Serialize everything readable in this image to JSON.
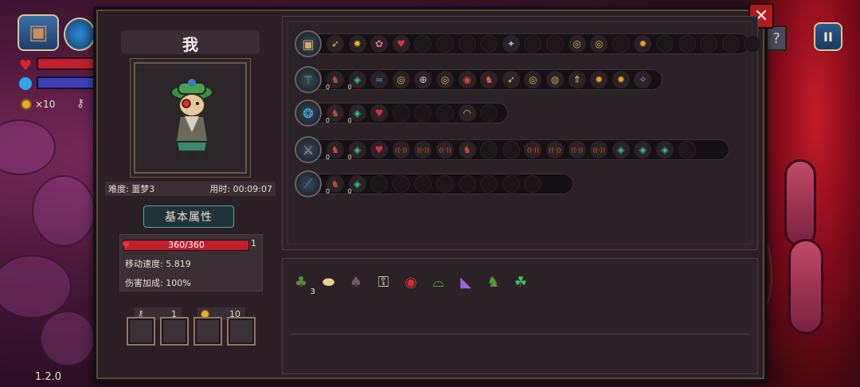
{
  "hud": {
    "coins": "×10",
    "version": "1.2.0",
    "pause_label": "II",
    "help_label": "?"
  },
  "panel": {
    "close_label": "✕"
  },
  "character": {
    "name": "我",
    "difficulty": "难度: 噩梦3",
    "time_used": "用时: 00:09:07",
    "attributes_button": "基本属性",
    "hp": "360/360",
    "armor": "1",
    "move_speed": "移动速度: 5.819",
    "damage_bonus": "伤害加成: 100%",
    "keys": "1",
    "gold": "10"
  },
  "weapon_rows": [
    {
      "main_icon": "chest-icon",
      "icons": [
        "feather-bolt-icon",
        "gold-orb-icon",
        "pink-gem-icon",
        "red-heart-icon",
        "empty",
        "empty",
        "empty",
        "empty",
        "blue-butterfly-icon",
        "empty",
        "empty",
        "golden-swirl-icon",
        "golden-swirl-icon",
        "empty",
        "sun-icon",
        "empty",
        "empty",
        "empty",
        "empty",
        "empty"
      ]
    },
    {
      "main_icon": "green-staff-icon",
      "icons": [
        "red-boot-icon",
        "teal-gem-icon",
        "blue-wave-icon",
        "golden-swirl-icon",
        "target-swirl-icon",
        "golden-swirl-icon",
        "red-swirl-icon",
        "fire-boot-icon",
        "feather-bolt-icon",
        "golden-swirl-icon",
        "dark-swirl-icon",
        "arrow-up-icon",
        "sun-icon",
        "sun-icon",
        "sparkle-icon"
      ],
      "counts": [
        "0",
        "0",
        "",
        "",
        "",
        "",
        "",
        "",
        "",
        "",
        "",
        "",
        "",
        "",
        ""
      ]
    },
    {
      "main_icon": "blue-orb-icon",
      "icons": [
        "red-boot-icon",
        "teal-gem-icon",
        "red-heart-icon",
        "empty",
        "empty",
        "empty",
        "rainbow-arc-icon",
        "empty"
      ],
      "counts": [
        "0",
        "0",
        "",
        "",
        "",
        "",
        "",
        ""
      ]
    },
    {
      "main_icon": "dark-staff-icon",
      "icons": [
        "red-boot-icon",
        "teal-gem-icon",
        "red-heart-icon",
        "radio-wave-icon",
        "radio-wave-icon",
        "radio-wave-icon",
        "red-boot-icon",
        "empty",
        "empty",
        "radio-wave-icon",
        "radio-wave-icon",
        "radio-wave-icon",
        "radio-wave-icon",
        "teal-gem-icon",
        "teal-gem-icon",
        "teal-gem-icon",
        "empty"
      ],
      "counts": [
        "0",
        "0",
        "",
        "",
        "",
        "",
        "",
        "",
        "",
        "",
        "",
        "",
        "",
        "",
        "",
        "",
        ""
      ]
    },
    {
      "main_icon": "blue-wand-icon",
      "icons": [
        "red-boot-icon",
        "teal-gem-icon",
        "empty",
        "empty",
        "empty",
        "empty",
        "empty",
        "empty",
        "empty",
        "empty"
      ],
      "counts": [
        "0",
        "0",
        "",
        "",
        "",
        "",
        "",
        "",
        "",
        ""
      ]
    }
  ],
  "items": [
    {
      "icon": "green-cloak-icon",
      "count": "3"
    },
    {
      "icon": "bread-loaf-icon",
      "count": ""
    },
    {
      "icon": "dark-bell-icon",
      "count": ""
    },
    {
      "icon": "bone-key-icon",
      "count": ""
    },
    {
      "icon": "red-eye-icon",
      "count": ""
    },
    {
      "icon": "green-hat-icon",
      "count": ""
    },
    {
      "icon": "rainbow-cape-icon",
      "count": ""
    },
    {
      "icon": "green-boot-icon",
      "count": ""
    },
    {
      "icon": "clover-icon",
      "count": ""
    }
  ],
  "icon_glyphs": {
    "chest-icon": "▣",
    "feather-bolt-icon": "➶",
    "gold-orb-icon": "✸",
    "pink-gem-icon": "✿",
    "red-heart-icon": "♥",
    "blue-butterfly-icon": "✦",
    "golden-swirl-icon": "◎",
    "sun-icon": "✹",
    "green-staff-icon": "⚚",
    "red-boot-icon": "♞",
    "teal-gem-icon": "◈",
    "blue-wave-icon": "≈",
    "target-swirl-icon": "⊕",
    "red-swirl-icon": "◉",
    "fire-boot-icon": "♞",
    "dark-swirl-icon": "◍",
    "arrow-up-icon": "⇑",
    "sparkle-icon": "✧",
    "blue-orb-icon": "❂",
    "rainbow-arc-icon": "◠",
    "dark-staff-icon": "⚔",
    "radio-wave-icon": "((·))",
    "blue-wand-icon": "⟋",
    "green-cloak-icon": "♣",
    "bread-loaf-icon": "⬬",
    "dark-bell-icon": "♠",
    "bone-key-icon": "⚿",
    "red-eye-icon": "◉",
    "green-hat-icon": "⌓",
    "rainbow-cape-icon": "◣",
    "green-boot-icon": "♞",
    "clover-icon": "☘",
    "empty": ""
  },
  "icon_colors": {
    "chest-icon": "#d9a866",
    "feather-bolt-icon": "#e8c040",
    "gold-orb-icon": "#f0b020",
    "pink-gem-icon": "#e87080",
    "red-heart-icon": "#d83040",
    "blue-butterfly-icon": "#7ac0f0",
    "golden-swirl-icon": "#e0b030",
    "sun-icon": "#f0a020",
    "green-staff-icon": "#6ac060",
    "red-boot-icon": "#c04a3a",
    "teal-gem-icon": "#30c0a0",
    "blue-wave-icon": "#40a0e0",
    "target-swirl-icon": "#d0c8c0",
    "red-swirl-icon": "#e04a30",
    "fire-boot-icon": "#e06030",
    "dark-swirl-icon": "#c8a040",
    "arrow-up-icon": "#e8d060",
    "sparkle-icon": "#c080f0",
    "blue-orb-icon": "#40b0f0",
    "rainbow-arc-icon": "#e0c020",
    "dark-staff-icon": "#a0a0b0",
    "radio-wave-icon": "#e06020",
    "blue-wand-icon": "#5080e0",
    "green-cloak-icon": "#5a8a40",
    "bread-loaf-icon": "#e8d090",
    "dark-bell-icon": "#6a5a6a",
    "bone-key-icon": "#d0c8c0",
    "red-eye-icon": "#d03030",
    "green-hat-icon": "#50a040",
    "rainbow-cape-icon": "#a060e0",
    "green-boot-icon": "#5a9a40",
    "clover-icon": "#40c060",
    "empty": "#1c1619"
  }
}
